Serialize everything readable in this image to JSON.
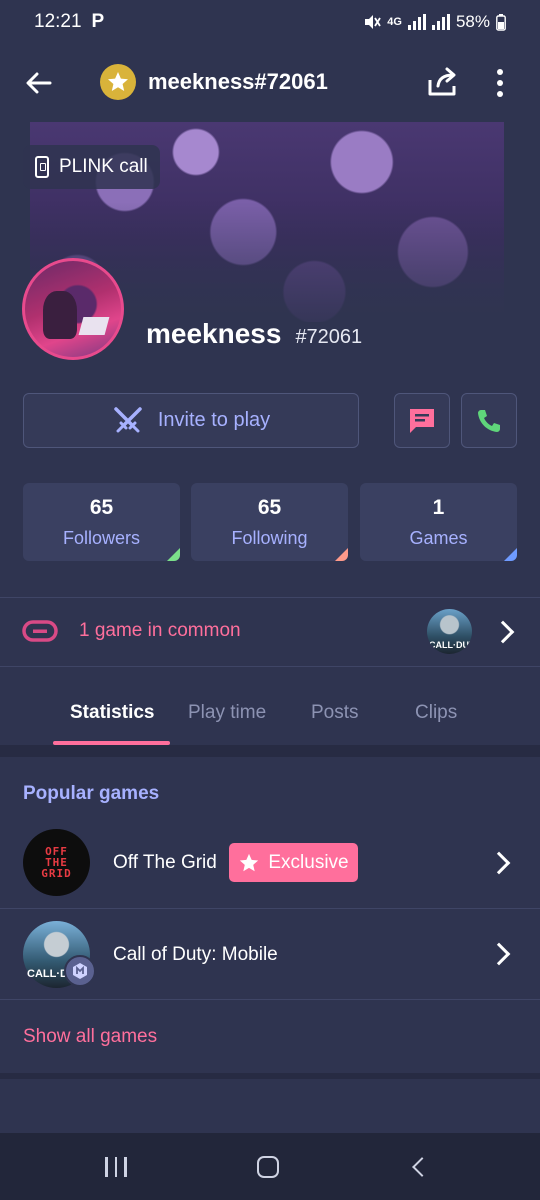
{
  "status_bar": {
    "time": "12:21",
    "app_indicator": "P",
    "network": "4G",
    "battery": "58%"
  },
  "app_bar": {
    "title": "meekness#72061"
  },
  "banner": {
    "call_chip_label": "PLINK call"
  },
  "profile": {
    "username": "meekness",
    "tag": "#72061"
  },
  "actions": {
    "invite_label": "Invite to play"
  },
  "stats": [
    {
      "value": "65",
      "label": "Followers",
      "accent": "#7be08a"
    },
    {
      "value": "65",
      "label": "Following",
      "accent": "#ff9a8a"
    },
    {
      "value": "1",
      "label": "Games",
      "accent": "#6f9bff"
    }
  ],
  "common": {
    "text": "1 game in common"
  },
  "tabs": [
    {
      "label": "Statistics",
      "active": true
    },
    {
      "label": "Play time",
      "active": false
    },
    {
      "label": "Posts",
      "active": false
    },
    {
      "label": "Clips",
      "active": false
    }
  ],
  "popular_games": {
    "title": "Popular games",
    "games": [
      {
        "name": "Off The Grid",
        "logo_text": "OFF THE GRID",
        "badge": "Exclusive"
      },
      {
        "name": "Call of Duty: Mobile",
        "logo_text": "CALL·D"
      }
    ],
    "show_all_label": "Show all games"
  },
  "small_game_avatar_text": "CALL·DUTY",
  "colors": {
    "background": "#2f3450",
    "accent_pink": "#ff6f9c",
    "accent_lavender": "#a7b1ff",
    "call_green": "#5fd57a"
  }
}
